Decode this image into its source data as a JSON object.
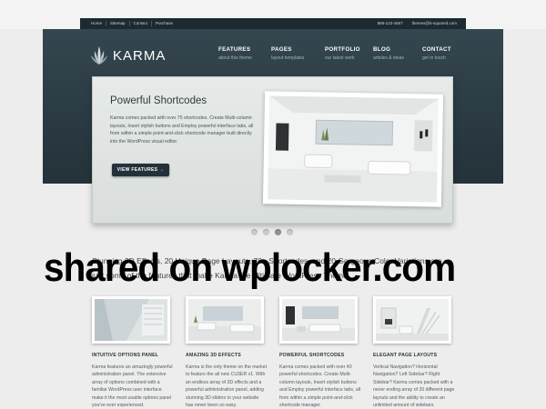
{
  "topbar": {
    "links": [
      "Home",
      "Sitemap",
      "Contact",
      "Purchase"
    ],
    "phone": "888-123-4567",
    "email": "themes@5-squared.com"
  },
  "logo": {
    "brand": "KARMA",
    "icon": "lotus-logo-icon"
  },
  "nav": [
    {
      "title": "FEATURES",
      "sub": "about this theme"
    },
    {
      "title": "PAGES",
      "sub": "layout templates"
    },
    {
      "title": "PORTFOLIO",
      "sub": "our latest work"
    },
    {
      "title": "BLOG",
      "sub": "articles & ideas"
    },
    {
      "title": "CONTACT",
      "sub": "get in touch"
    }
  ],
  "hero": {
    "title": "Powerful Shortcodes",
    "description": "Karma comes packed with over 75 shortcodes. Create Multi-column layouts, Insert stylish buttons and Employ powerful interface tabs, all from within a simple point-and-click shortcode manager built directly into the WordPress visual editor.",
    "button": "VIEW FEATURES →"
  },
  "slider_dots": 4,
  "tagline": "Stunning 3D Effects, 20 Unique Page Layouts, 70+ Shortcodes, and 20 Gorgeous Color Variations are just some of the features that make Karma the Ultimate WordPress Theme.",
  "watermark": "shared on wplocker.com",
  "features": [
    {
      "title": "INTUITIVE OPTIONS PANEL",
      "desc": "Karma features an amazingly powerful administration panel. The extensive array of options combined with a familiar WordPress user interface make it the most usable options panel you've ever experienced."
    },
    {
      "title": "AMAZING 3D EFFECTS",
      "desc": "Karma is the only theme on the market to feature the all new CU3ER v1. With an endless array of 3D effects and a powerful administration panel, adding stunning 3D sliders to your website has never been so easy."
    },
    {
      "title": "POWERFUL SHORTCODES",
      "desc": "Karma comes packed with over 40 powerful shortcodes. Create Multi-column layouts, Insert stylish buttons and Employ powerful interface tabs, all from within a simple point-and-click shortcode manager."
    },
    {
      "title": "ELEGANT PAGE LAYOUTS",
      "desc": "Vertical Navigation? Horizontal Navigation? Left Sidebar? Right Sidebar? Karma comes packed with a never ending array of 20 different page layouts and the ability to create an unlimited amount of sidebars."
    }
  ]
}
